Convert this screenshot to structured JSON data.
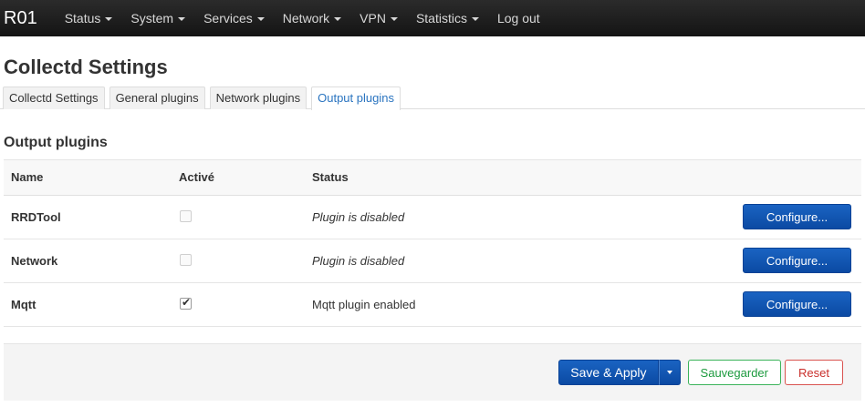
{
  "navbar": {
    "brand": "R01",
    "items": [
      {
        "label": "Status",
        "dropdown": true
      },
      {
        "label": "System",
        "dropdown": true
      },
      {
        "label": "Services",
        "dropdown": true
      },
      {
        "label": "Network",
        "dropdown": true
      },
      {
        "label": "VPN",
        "dropdown": true
      },
      {
        "label": "Statistics",
        "dropdown": true
      },
      {
        "label": "Log out",
        "dropdown": false
      }
    ]
  },
  "page": {
    "title": "Collectd Settings"
  },
  "tabs": [
    {
      "label": "Collectd Settings",
      "active": false
    },
    {
      "label": "General plugins",
      "active": false
    },
    {
      "label": "Network plugins",
      "active": false
    },
    {
      "label": "Output plugins",
      "active": true
    }
  ],
  "section": {
    "title": "Output plugins",
    "columns": {
      "name": "Name",
      "active": "Activé",
      "status": "Status"
    },
    "rows": [
      {
        "name": "RRDTool",
        "enabled": false,
        "status": "Plugin is disabled",
        "configure": "Configure..."
      },
      {
        "name": "Network",
        "enabled": false,
        "status": "Plugin is disabled",
        "configure": "Configure..."
      },
      {
        "name": "Mqtt",
        "enabled": true,
        "status": "Mqtt plugin enabled",
        "configure": "Configure..."
      }
    ]
  },
  "actions": {
    "save_apply": "Save & Apply",
    "save": "Sauvegarder",
    "reset": "Reset"
  },
  "colors": {
    "navbar_bg": "#1e1e1e",
    "primary": "#1a63c2",
    "tab_active_text": "#2a74c0",
    "save_green": "#1c9a3e",
    "reset_red": "#c9302c"
  }
}
